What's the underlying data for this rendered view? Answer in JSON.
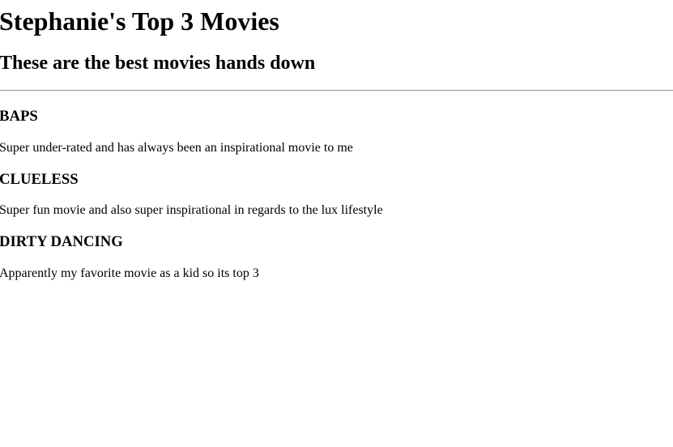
{
  "page": {
    "title": "Stephanie's Top 3 Movies",
    "subtitle": "These are the best movies hands down"
  },
  "movies": [
    {
      "title": "BAPS",
      "description": "Super under-rated and has always been an inspirational movie to me"
    },
    {
      "title": "CLUELESS",
      "description": "Super fun movie and also super inspirational in regards to the lux lifestyle"
    },
    {
      "title": "DIRTY DANCING",
      "description": "Apparently my favorite movie as a kid so its top 3"
    }
  ]
}
